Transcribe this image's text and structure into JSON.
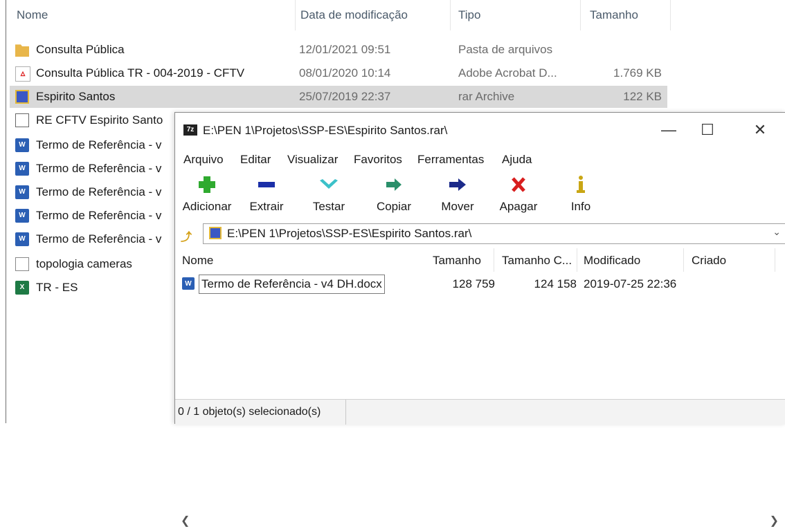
{
  "explorer": {
    "columns": {
      "name": "Nome",
      "date": "Data de modificação",
      "type": "Tipo",
      "size": "Tamanho"
    },
    "rows": [
      {
        "name": "Consulta Pública",
        "date": "12/01/2021 09:51",
        "type": "Pasta de arquivos",
        "size": "",
        "icon": "folder-icon"
      },
      {
        "name": "Consulta Pública TR - 004-2019 - CFTV",
        "date": "08/01/2020 10:14",
        "type": "Adobe Acrobat D...",
        "size": "1.769 KB",
        "icon": "pdf-icon"
      },
      {
        "name": "Espirito Santos",
        "date": "25/07/2019 22:37",
        "type": "rar Archive",
        "size": "122 KB",
        "icon": "rar-archive-icon"
      },
      {
        "name": "RE  CFTV Espirito Santo",
        "icon": "mail-icon"
      },
      {
        "name": "Termo de Referência - v",
        "icon": "word-document-icon"
      },
      {
        "name": "Termo de Referência - v",
        "icon": "word-document-icon"
      },
      {
        "name": "Termo de Referência - v",
        "icon": "word-document-icon"
      },
      {
        "name": "Termo de Referência - v",
        "icon": "word-document-icon"
      },
      {
        "name": "Termo de Referência - v",
        "icon": "word-document-icon"
      },
      {
        "name": "topologia cameras",
        "icon": "image-file-icon"
      },
      {
        "name": "TR - ES",
        "icon": "excel-file-icon"
      }
    ]
  },
  "sevenzip": {
    "app_icon": "7z",
    "title": "E:\\PEN 1\\Projetos\\SSP-ES\\Espirito Santos.rar\\",
    "window_controls": {
      "minimize": "—",
      "maximize": "☐",
      "close": "✕"
    },
    "menu": [
      "Arquivo",
      "Editar",
      "Visualizar",
      "Favoritos",
      "Ferramentas",
      "Ajuda"
    ],
    "toolbar": {
      "add": "Adicionar",
      "extract": "Extrair",
      "test": "Testar",
      "copy": "Copiar",
      "move": "Mover",
      "delete": "Apagar",
      "info": "Info"
    },
    "address": "E:\\PEN 1\\Projetos\\SSP-ES\\Espirito Santos.rar\\",
    "list_columns": {
      "name": "Nome",
      "size": "Tamanho",
      "packed": "Tamanho C...",
      "modified": "Modificado",
      "created": "Criado"
    },
    "files": [
      {
        "name": "Termo de Referência - v4 DH.docx",
        "size": "128 759",
        "packed": "124 158",
        "modified": "2019-07-25 22:36"
      }
    ],
    "status": "0 / 1 objeto(s) selecionado(s)"
  }
}
